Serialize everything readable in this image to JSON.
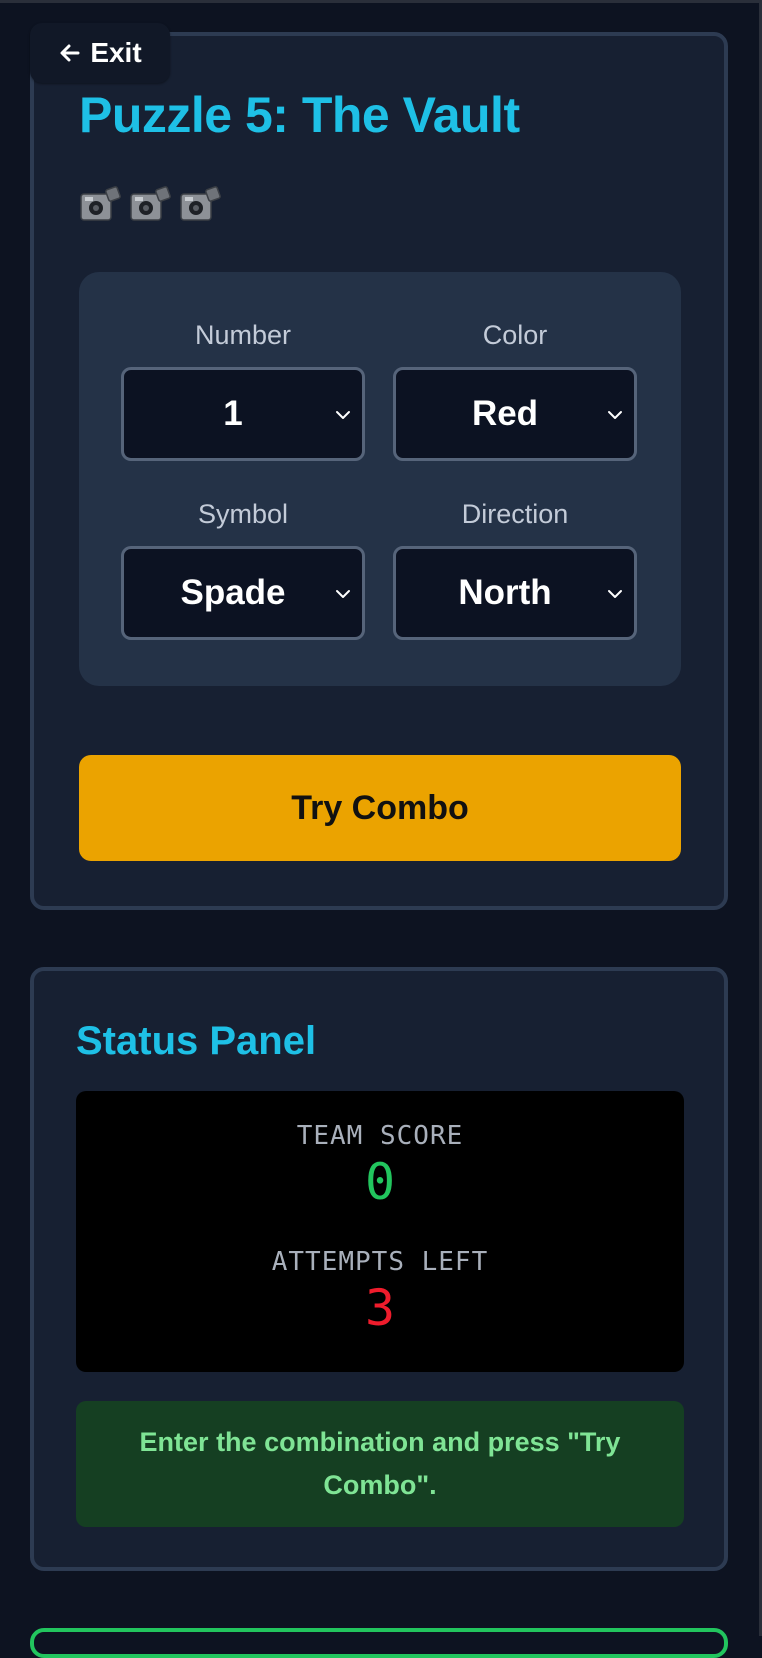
{
  "header": {
    "exit_label": "Exit"
  },
  "puzzle": {
    "title": "Puzzle 5: The Vault",
    "camera_icons": [
      "video-camera-icon",
      "video-camera-icon",
      "video-camera-icon"
    ],
    "fields": [
      {
        "label": "Number",
        "value": "1"
      },
      {
        "label": "Color",
        "value": "Red"
      },
      {
        "label": "Symbol",
        "value": "Spade"
      },
      {
        "label": "Direction",
        "value": "North"
      }
    ],
    "submit_label": "Try Combo"
  },
  "status": {
    "title": "Status Panel",
    "score_label": "TEAM SCORE",
    "score_value": "0",
    "attempts_label": "ATTEMPTS LEFT",
    "attempts_value": "3",
    "message": "Enter the combination and press \"Try Combo\"."
  },
  "colors": {
    "accent": "#1ec0e6",
    "button": "#eba300",
    "score_green": "#22c55e",
    "attempts_red": "#ef1c2c",
    "message_bg": "#153f22",
    "message_text": "#7fe495"
  }
}
